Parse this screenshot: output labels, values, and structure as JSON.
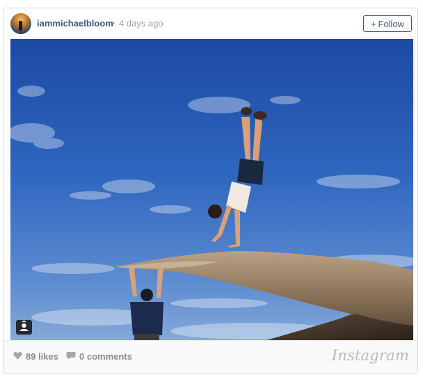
{
  "post": {
    "username": "iammichaelbloom",
    "separator": "•",
    "time_ago": "4 days ago",
    "follow_label": "Follow",
    "follow_icon": "plus-icon"
  },
  "photo": {
    "description_icon": "user-tag-icon"
  },
  "footer": {
    "likes": "89 likes",
    "comments": "0 comments",
    "brand": "Instagram",
    "like_icon": "heart-icon",
    "comment_icon": "comment-bubble-icon"
  },
  "colors": {
    "username": "#3b5a7a",
    "follow_border": "#3b5a7a",
    "meta_text": "#a0a0a0",
    "footer_text": "#8a8a8a",
    "sky_top": "#1e4fa8",
    "sky_bottom": "#7fa5d4"
  }
}
